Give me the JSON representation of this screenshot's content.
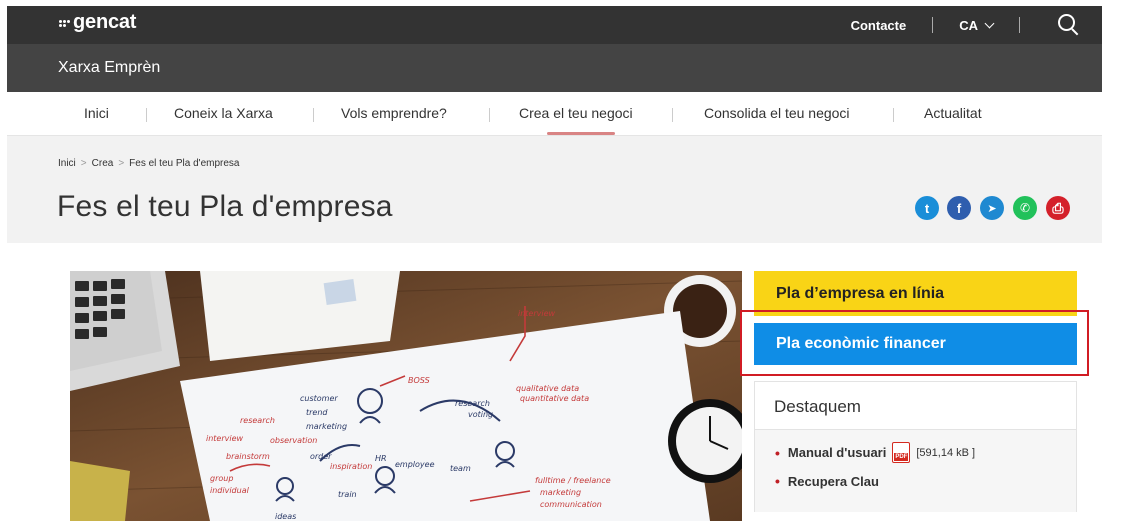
{
  "header": {
    "logo_text": "gencat",
    "contact_label": "Contacte",
    "lang_label": "CA"
  },
  "site": {
    "title": "Xarxa Emprèn"
  },
  "nav": {
    "items": [
      {
        "label": "Inici"
      },
      {
        "label": "Coneix la Xarxa"
      },
      {
        "label": "Vols emprendre?"
      },
      {
        "label": "Crea el teu negoci"
      },
      {
        "label": "Consolida el teu negoci"
      },
      {
        "label": "Actualitat"
      }
    ],
    "active": "Crea el teu negoci"
  },
  "breadcrumb": {
    "items": [
      {
        "label": "Inici"
      },
      {
        "label": "Crea"
      },
      {
        "label": "Fes el teu Pla d'empresa"
      }
    ],
    "separator": ">"
  },
  "page": {
    "title": "Fes el teu Pla d'empresa"
  },
  "share": {
    "icons": [
      {
        "name": "twitter-icon",
        "glyph": "t",
        "color": "#1a8ed8"
      },
      {
        "name": "facebook-icon",
        "glyph": "f",
        "color": "#2f5eae"
      },
      {
        "name": "telegram-icon",
        "glyph": "➤",
        "color": "#1f89d1"
      },
      {
        "name": "whatsapp-icon",
        "glyph": "✆",
        "color": "#21c15a"
      },
      {
        "name": "print-icon",
        "glyph": "⎙",
        "color": "#d4202a"
      }
    ]
  },
  "sidebar": {
    "yellow_label": "Pla d’empresa en línia",
    "blue_label": "Pla econòmic financer",
    "destaquem_title": "Destaquem",
    "links": [
      {
        "label": "Manual d'usuari",
        "pdf": "PDF",
        "size": "[591,14 kB ]"
      },
      {
        "label": "Recupera Clau"
      }
    ]
  },
  "photo": {
    "notes": [
      "interview",
      "research",
      "observation",
      "brainstorm",
      "group",
      "individual",
      "customer",
      "trend",
      "marketing",
      "BOSS",
      "research",
      "voting",
      "qualitative data",
      "quantitative data",
      "order",
      "inspiration",
      "HR",
      "employee",
      "train",
      "team",
      "fulltime / freelance",
      "marketing",
      "communication",
      "ideas"
    ]
  },
  "colors": {
    "yellow": "#f9d416",
    "blue": "#0f8de6",
    "highlight": "#d11c24",
    "topbar": "#333333"
  }
}
